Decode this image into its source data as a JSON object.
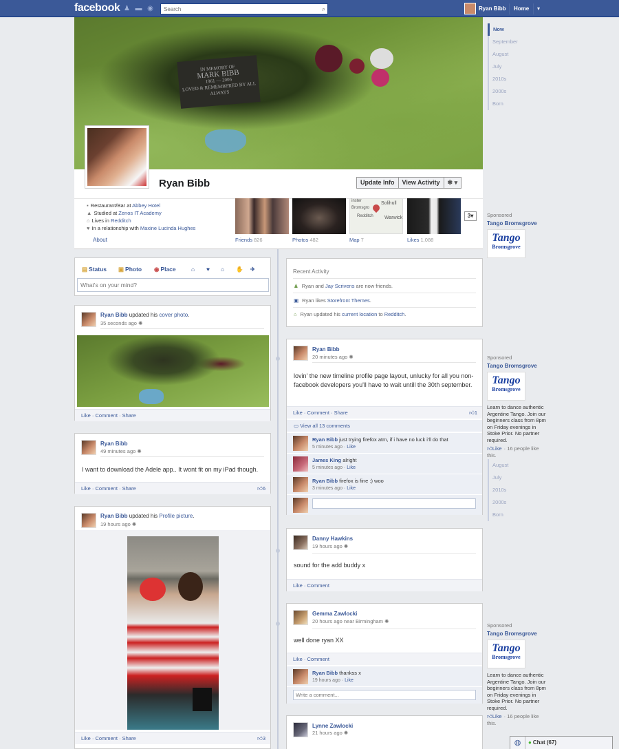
{
  "topbar": {
    "logo": "facebook",
    "search_placeholder": "Search",
    "user_name": "Ryan Bibb",
    "home_label": "Home",
    "dropdown_icon": "▾",
    "search_icon": "⌕"
  },
  "cover": {
    "plaque_line1": "IN MEMORY OF",
    "plaque_line2": "MARK BIBB",
    "plaque_line3": "1961 — 2006",
    "plaque_line4": "LOVED & REMEMBERED BY ALL",
    "plaque_line5": "ALWAYS"
  },
  "profile": {
    "name": "Ryan Bibb",
    "update_info": "Update Info",
    "view_activity": "View Activity",
    "gear": "✱ ▾"
  },
  "info": {
    "work_prefix": "Restaurant/Bar at ",
    "work_link": "Abbey Hotel",
    "study_prefix": "Studied at ",
    "study_link": "Zenos IT Academy",
    "lives_prefix": "Lives in ",
    "lives_link": "Redditch",
    "rel_prefix": "In a relationship with ",
    "rel_link": "Maxine Lucinda Hughes",
    "about": "About"
  },
  "tiles": {
    "friends_label": "Friends",
    "friends_count": "826",
    "photos_label": "Photos",
    "photos_count": "482",
    "map_label": "Map",
    "map_count": "7",
    "likes_label": "Likes",
    "likes_count": "1,088",
    "more": "3▾",
    "map_town1": "Solihull",
    "map_town2": "Redditch",
    "map_town3": "Warwick",
    "map_town4": "Bromsgro",
    "map_town5": "inster"
  },
  "timeline_nav": [
    "Now",
    "September",
    "August",
    "July",
    "2010s",
    "2000s",
    "Born"
  ],
  "timeline_nav2": [
    "August",
    "July",
    "2010s",
    "2000s",
    "Born"
  ],
  "composer": {
    "status": "Status",
    "photo": "Photo",
    "place": "Place",
    "placeholder": "What's on your mind?"
  },
  "recent": {
    "title": "Recent Activity",
    "a1_pre": "Ryan and ",
    "a1_link": "Jay Scrivens",
    "a1_post": " are now friends.",
    "a2_pre": "Ryan likes ",
    "a2_link": "Storefront Themes",
    "a2_post": ".",
    "a3_pre": "Ryan updated his ",
    "a3_link": "current location",
    "a3_mid": " to ",
    "a3_link2": "Redditch",
    "a3_post": "."
  },
  "actions": {
    "like": "Like",
    "comment": "Comment",
    "share": "Share",
    "sep": " · "
  },
  "post1": {
    "name": "Ryan Bibb",
    "action": " updated his ",
    "link": "cover photo",
    "end": ".",
    "time": "35 seconds ago"
  },
  "post2": {
    "name": "Ryan Bibb",
    "time": "49 minutes ago",
    "text": "I want to download the Adele app.. It wont fit on my iPad though.",
    "likes": "6"
  },
  "post3": {
    "name": "Ryan Bibb",
    "action": " updated his ",
    "link": "Profile picture",
    "end": ".",
    "time": "19 hours ago",
    "likes": "3"
  },
  "post4": {
    "name": "Ryan Bibb",
    "time": "20 minutes ago",
    "text": "lovin' the new timeline profile page layout, unlucky for all you non-facebook developers you'll have to wait untill the 30th september.",
    "likes": "1",
    "view_all": "View all 13 comments",
    "comments": [
      {
        "name": "Ryan Bibb",
        "text": " just trying firefox atm, if i have no luck i'll do that",
        "time": "5 minutes ago",
        "like": "Like"
      },
      {
        "name": "James King",
        "text": " alright",
        "time": "5 minutes ago",
        "like": "Like"
      },
      {
        "name": "Ryan Bibb",
        "text": " firefox is fine :) woo",
        "time": "3 minutes ago",
        "like": "Like"
      }
    ]
  },
  "post5": {
    "name": "Danny Hawkins",
    "time": "19 hours ago",
    "text": "sound for the add buddy x"
  },
  "post6": {
    "name": "Gemma Zawlocki",
    "time": "20 hours ago near Birmingham",
    "text": "well done ryan XX",
    "reply_name": "Ryan Bibb",
    "reply_text": " thankss x",
    "reply_time": "19 hours ago",
    "reply_like": "Like",
    "comment_placeholder": "Write a comment..."
  },
  "post7": {
    "name": "Lynne Zawlocki",
    "time": "21 hours ago"
  },
  "sponsored": {
    "label": "Sponsored",
    "title": "Tango Bromsgrove",
    "logo1": "Tango",
    "logo2": "Bromsgrove",
    "body": "Learn to dance authentic Argentine Tango. Join our beginners class from 8pm on Friday evenings in Stoke Prior. No partner required.",
    "like": "Like",
    "people": "· 16 people like this."
  },
  "chat": {
    "label": "Chat (67)"
  }
}
